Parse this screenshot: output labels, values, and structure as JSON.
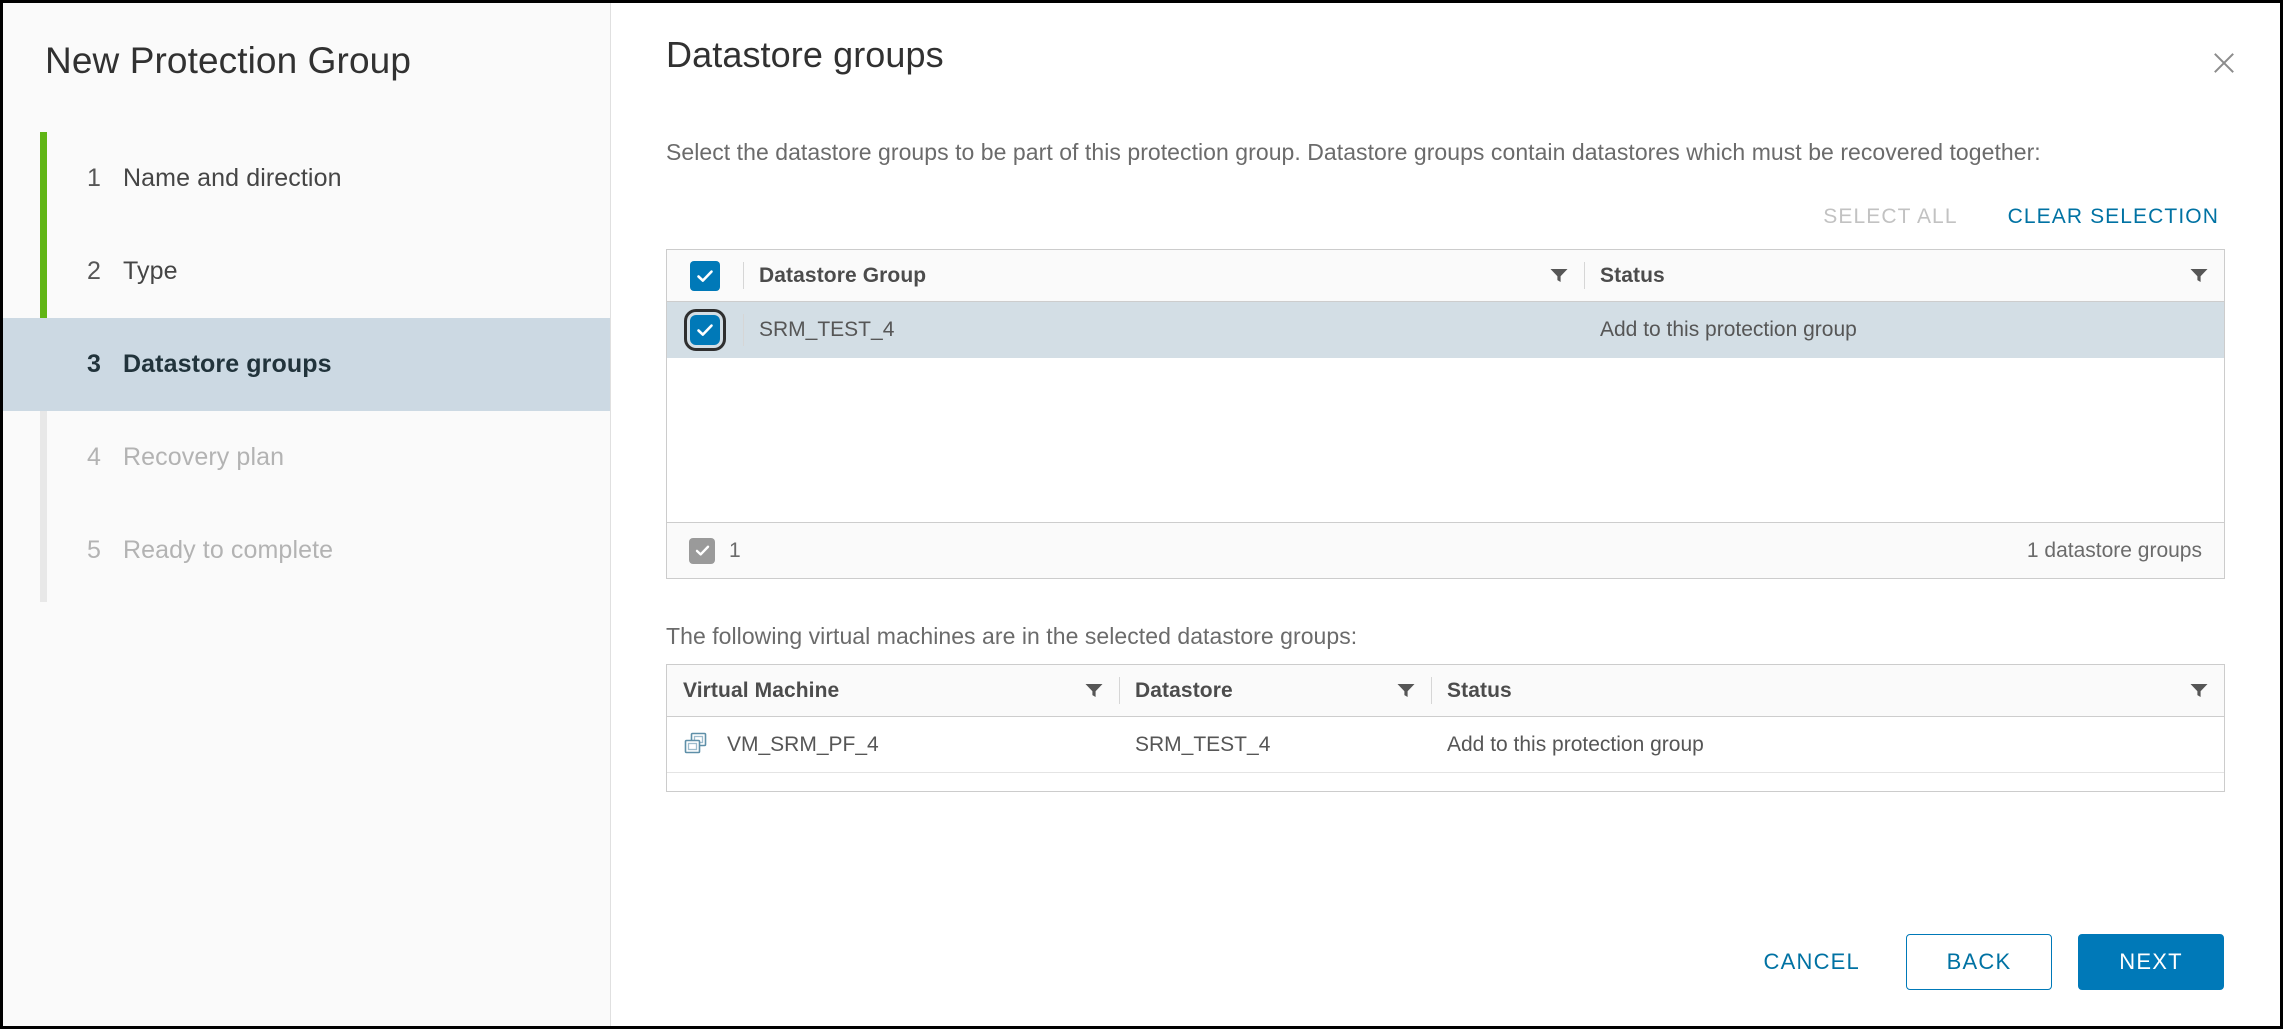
{
  "wizard": {
    "title": "New Protection Group",
    "steps": [
      {
        "num": "1",
        "label": "Name and direction",
        "state": "done"
      },
      {
        "num": "2",
        "label": "Type",
        "state": "done"
      },
      {
        "num": "3",
        "label": "Datastore groups",
        "state": "active"
      },
      {
        "num": "4",
        "label": "Recovery plan",
        "state": "disabled"
      },
      {
        "num": "5",
        "label": "Ready to complete",
        "state": "disabled"
      }
    ]
  },
  "page": {
    "title": "Datastore groups",
    "close_icon": "close-icon",
    "description": "Select the datastore groups to be part of this protection group. Datastore groups contain datastores which must be recovered together:"
  },
  "toolbar": {
    "select_all_label": "SELECT ALL",
    "clear_selection_label": "CLEAR SELECTION"
  },
  "datastore_table": {
    "columns": [
      {
        "label": "Datastore Group",
        "filter_icon": "filter-funnel-icon"
      },
      {
        "label": "Status",
        "filter_icon": "filter-funnel-icon"
      }
    ],
    "rows": [
      {
        "name": "SRM_TEST_4",
        "status": "Add to this protection group",
        "checked": true,
        "selected": true
      }
    ],
    "footer": {
      "selected_count": "1",
      "total_label": "1 datastore groups"
    }
  },
  "vm_section": {
    "description": "The following virtual machines are in the selected datastore groups:",
    "columns": [
      {
        "label": "Virtual Machine",
        "filter_icon": "filter-funnel-icon"
      },
      {
        "label": "Datastore",
        "filter_icon": "filter-funnel-icon"
      },
      {
        "label": "Status",
        "filter_icon": "filter-funnel-icon"
      }
    ],
    "rows": [
      {
        "icon": "virtual-machine-icon",
        "name": "VM_SRM_PF_4",
        "datastore": "SRM_TEST_4",
        "status": "Add to this protection group"
      }
    ]
  },
  "footer_buttons": {
    "cancel": "CANCEL",
    "back": "BACK",
    "next": "NEXT"
  },
  "colors": {
    "accent_blue": "#0079b8",
    "link_blue": "#0072a3",
    "progress_green": "#60b515",
    "selected_row": "#d3dee5",
    "active_step": "#ccd9e3"
  }
}
